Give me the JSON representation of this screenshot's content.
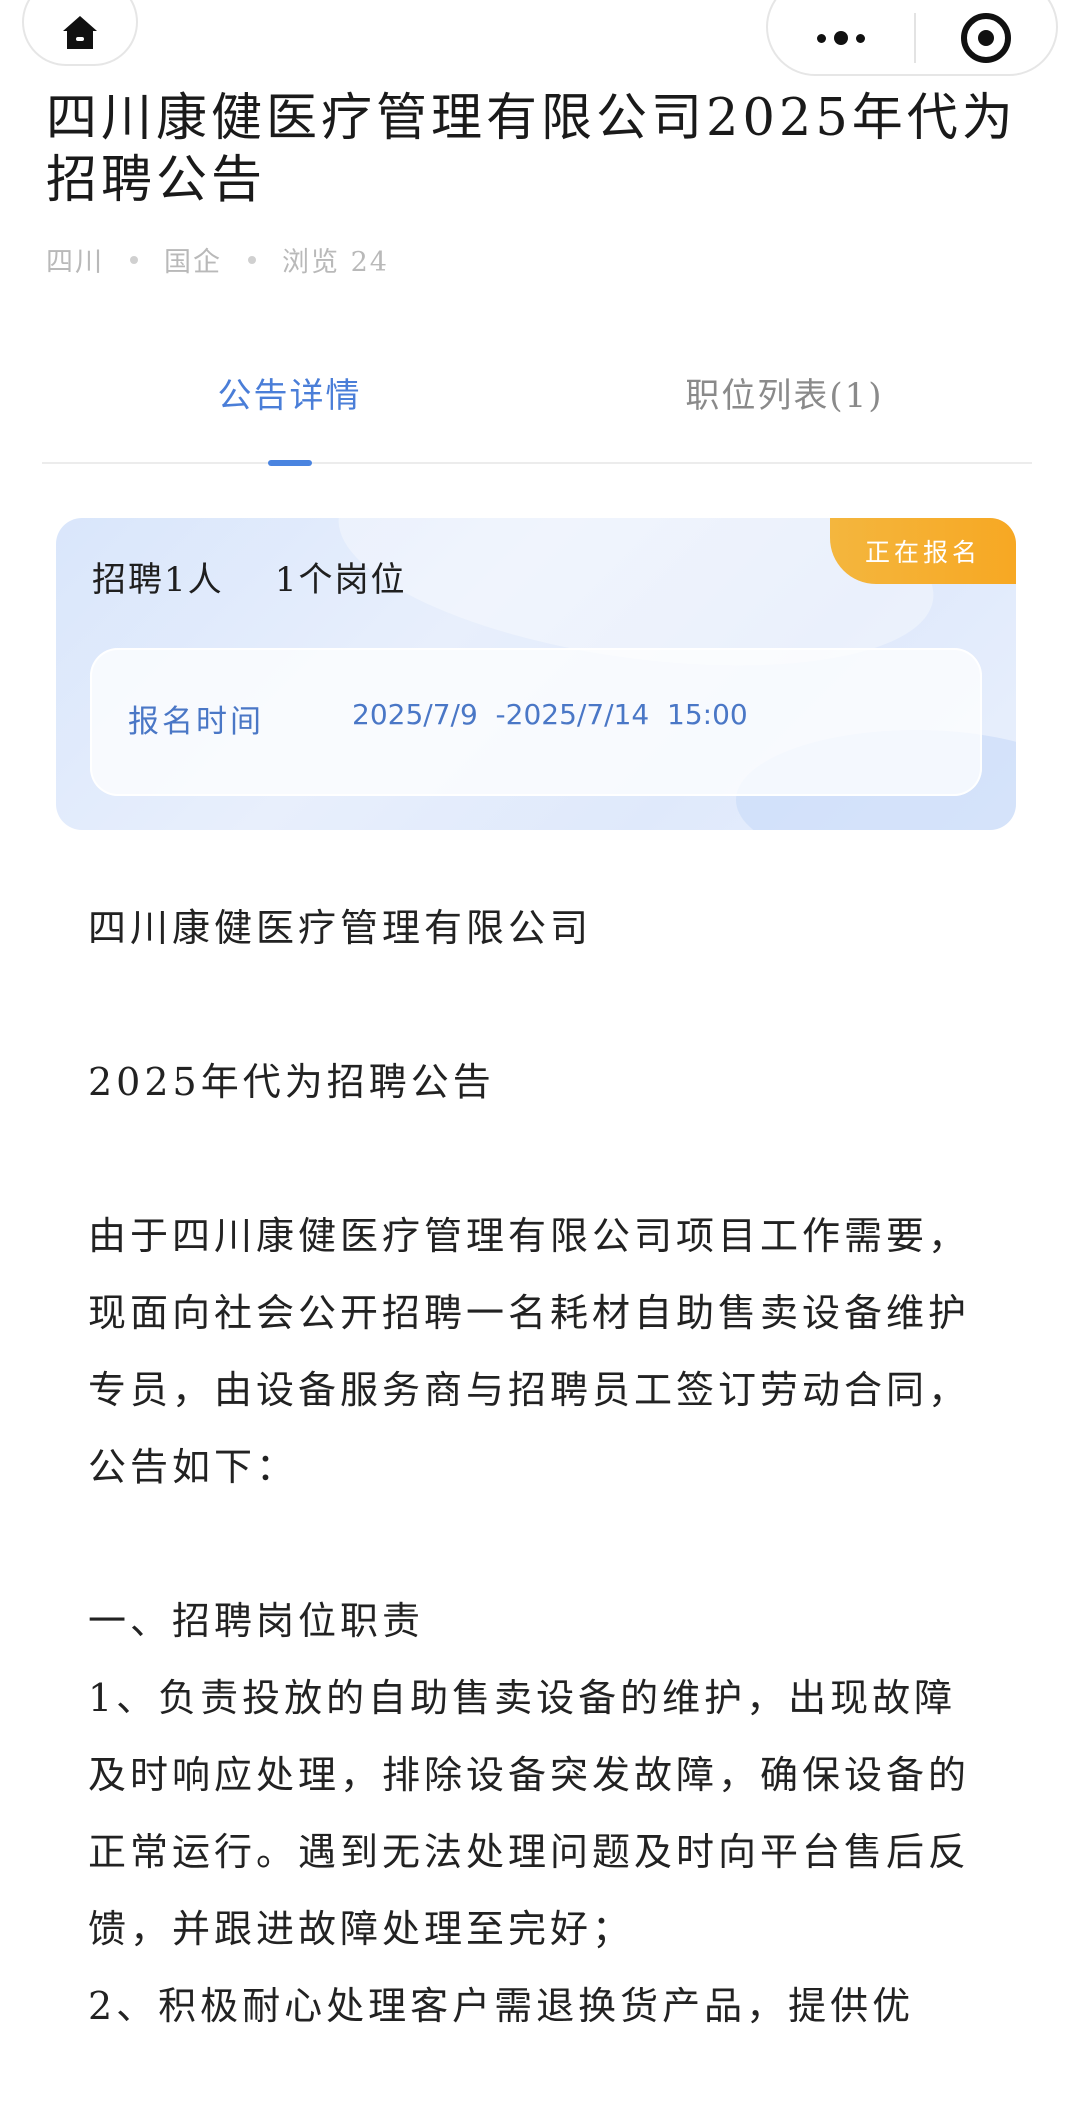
{
  "topbar": {
    "home_icon": "home-icon",
    "more_icon": "more-dots-icon",
    "close_icon": "target-close-icon"
  },
  "title": "四川康健医疗管理有限公司2025年代为招聘公告",
  "meta": {
    "region": "四川",
    "type": "国企",
    "views": "浏览 24"
  },
  "tabs": [
    {
      "label": "公告详情",
      "active": true
    },
    {
      "label": "职位列表(1)",
      "active": false
    }
  ],
  "card": {
    "summary": "招聘1人    1个岗位",
    "badge": "正在报名",
    "time_label": "报名时间",
    "time_value": "2025/7/9  -2025/7/14  15:00",
    "badge_color": "#f6ad2a",
    "accent_color": "#4a77c6"
  },
  "content": {
    "company": "四川康健医疗管理有限公司",
    "heading": "2025年代为招聘公告",
    "intro": "由于四川康健医疗管理有限公司项目工作需要，现面向社会公开招聘一名耗材自助售卖设备维护专员，由设备服务商与招聘员工签订劳动合同，公告如下：",
    "section1_title": "一、招聘岗位职责",
    "item1": "1、负责投放的自助售卖设备的维护，出现故障及时响应处理，排除设备突发故障，确保设备的正常运行。遇到无法处理问题及时向平台售后反馈，并跟进故障处理至完好；",
    "item2": "2、积极耐心处理客户需退换货产品，提供优"
  }
}
